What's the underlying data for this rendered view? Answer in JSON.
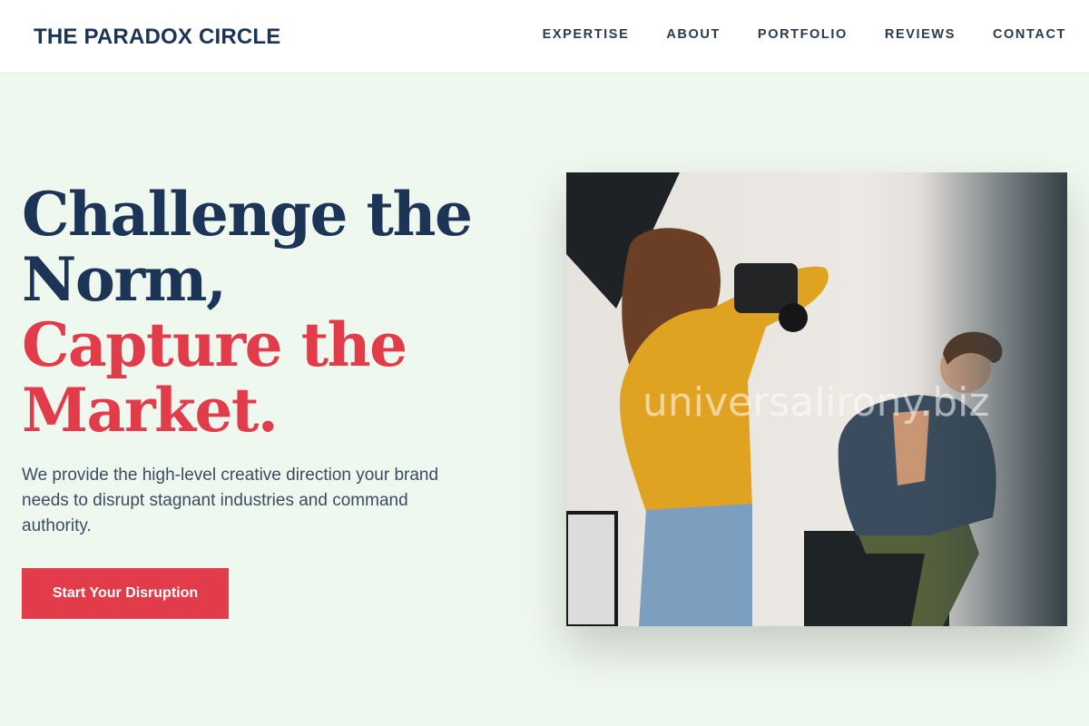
{
  "brand": "THE PARADOX CIRCLE",
  "nav": [
    "EXPERTISE",
    "ABOUT",
    "PORTFOLIO",
    "REVIEWS",
    "CONTACT"
  ],
  "hero": {
    "title_line1": "Challenge the",
    "title_line2": "Norm,",
    "title_line3": "Capture the",
    "title_line4": "Market.",
    "description": "We provide the high-level creative direction your brand needs to disrupt stagnant industries and command authority.",
    "cta_label": "Start Your Disruption"
  },
  "photo": {
    "watermark": "universalirony.biz"
  },
  "colors": {
    "primary_navy": "#1c3557",
    "accent_red": "#e23b4a",
    "background_mint": "#eff8ef"
  }
}
